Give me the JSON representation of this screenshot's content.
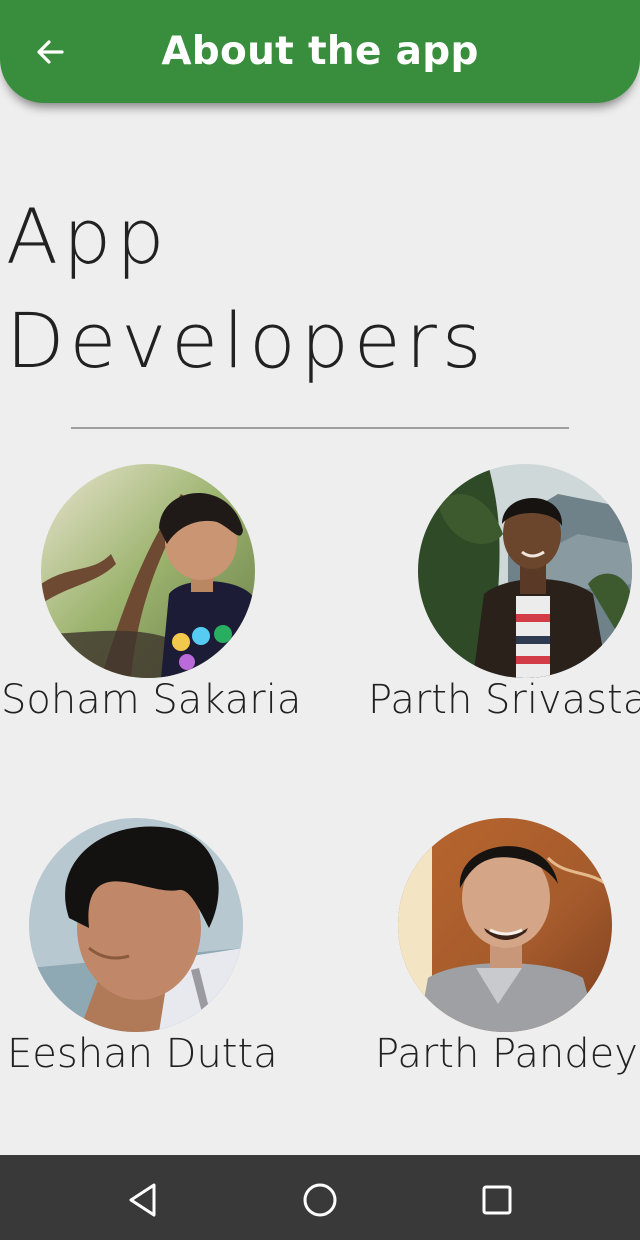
{
  "app_bar": {
    "title": "About the app",
    "back_icon": "arrow-left-icon",
    "color": "#388e3c"
  },
  "section": {
    "title": "App\nDevelopers"
  },
  "developers": [
    {
      "name": "Soham Sakaria"
    },
    {
      "name": "Parth Srivasta"
    },
    {
      "name": "Eeshan Dutta"
    },
    {
      "name": "Parth Pandey"
    }
  ],
  "nav_bar": {
    "back_icon": "triangle-back-icon",
    "home_icon": "circle-home-icon",
    "recents_icon": "square-recents-icon"
  }
}
